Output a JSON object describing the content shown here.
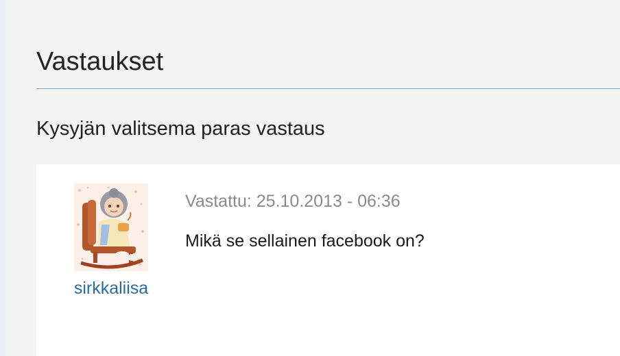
{
  "page": {
    "section_title": "Vastaukset",
    "best_answer_heading": "Kysyjän valitsema paras vastaus"
  },
  "answer": {
    "author": "sirkkaliisa",
    "meta": "Vastattu: 25.10.2013 - 06:36",
    "text": "Mikä se sellainen facebook on?"
  },
  "colors": {
    "background": "#f4f4f5",
    "card": "#ffffff",
    "divider": "#7aa6c4",
    "author_link": "#2b6b9c",
    "meta_text": "#8a8a8a"
  }
}
